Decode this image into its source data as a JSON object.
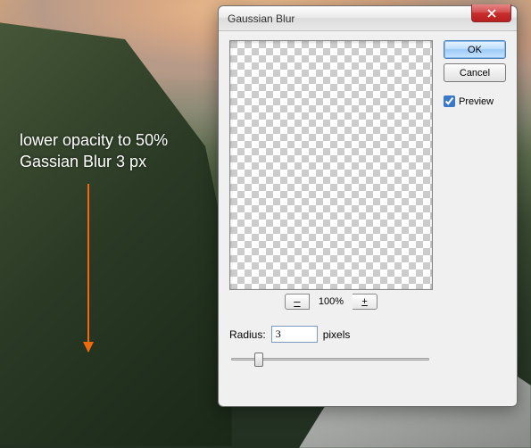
{
  "annotation": {
    "line1": "lower opacity to 50%",
    "line2": "Gassian Blur 3 px"
  },
  "dialog": {
    "title": "Gaussian Blur",
    "ok_label": "OK",
    "cancel_label": "Cancel",
    "preview_label": "Preview",
    "preview_checked": true,
    "zoom": {
      "minus": "–",
      "plus": "+",
      "level": "100%"
    },
    "radius": {
      "label": "Radius:",
      "value": "3",
      "unit": "pixels"
    }
  }
}
